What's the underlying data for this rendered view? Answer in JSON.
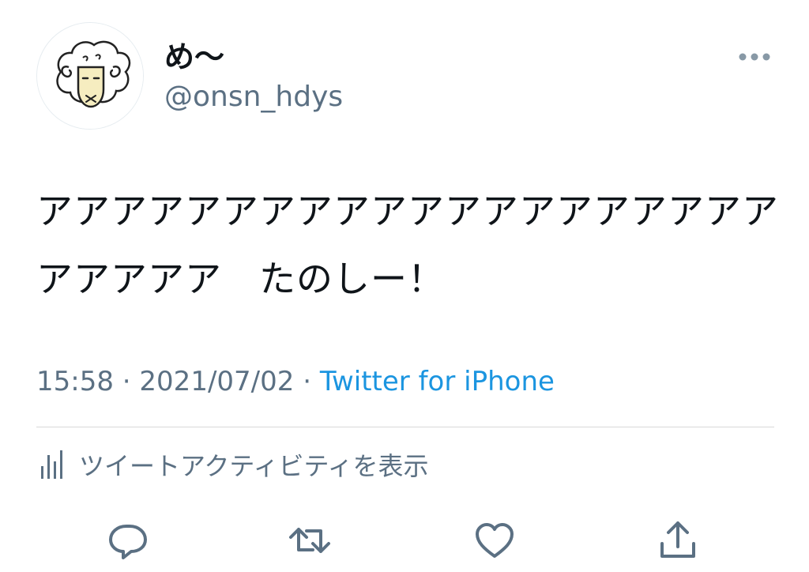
{
  "user": {
    "display_name": "め〜",
    "handle": "@onsn_hdys",
    "avatar_icon": "sheep-avatar"
  },
  "tweet": {
    "text": "アアアアアアアアアアアアアアアアアアアアアアアアア　たのしー！",
    "time": "15:58",
    "separator": "·",
    "date": "2021/07/02",
    "source": "Twitter for iPhone"
  },
  "activity": {
    "icon": "analytics-icon",
    "label": "ツイートアクティビティを表示"
  },
  "actions": [
    {
      "icon": "reply-icon"
    },
    {
      "icon": "retweet-icon"
    },
    {
      "icon": "like-icon"
    },
    {
      "icon": "share-icon"
    }
  ],
  "colors": {
    "text": "#0f1419",
    "secondary": "#5b7083",
    "link": "#1b95e0",
    "divider": "#d9d9d9"
  }
}
